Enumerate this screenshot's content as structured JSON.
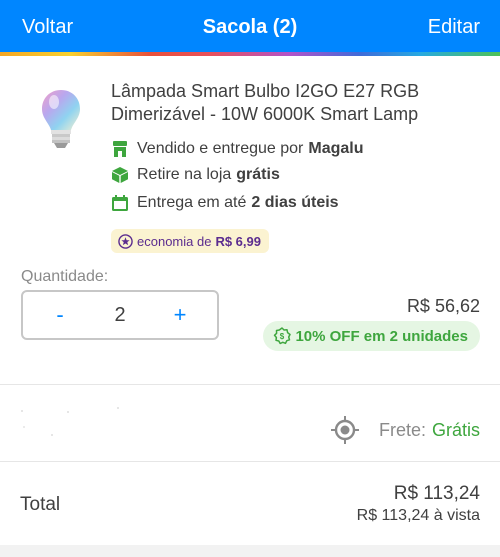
{
  "header": {
    "back_label": "Voltar",
    "title": "Sacola (2)",
    "edit_label": "Editar",
    "color": "#0086ff"
  },
  "product": {
    "name": "Lâmpada Smart Bulbo I2GO E27 RGB Dimerizável - 10W 6000K Smart Lamp",
    "image_icon": "smart-bulb-image",
    "seller_prefix": "Vendido e entregue por",
    "seller_name": "Magalu",
    "pickup_prefix": "Retire na loja",
    "pickup_value": "grátis",
    "delivery_prefix": "Entrega em até",
    "delivery_value": "2 dias úteis",
    "savings_prefix": "economia de",
    "savings_value": "R$ 6,99"
  },
  "quantity": {
    "label": "Quantidade:",
    "minus": "-",
    "value": "2",
    "plus": "+"
  },
  "price": {
    "value": "R$ 56,62",
    "discount_label": "10% OFF em 2 unidades"
  },
  "shipping": {
    "label": "Frete:",
    "value": "Grátis",
    "icon": "location-target-icon"
  },
  "total": {
    "label": "Total",
    "value": "R$ 113,24",
    "cash_value": "R$ 113,24 à vista"
  },
  "colors": {
    "accent": "#0086ff",
    "green": "#3ea63e",
    "purple": "#5b2c8f"
  }
}
